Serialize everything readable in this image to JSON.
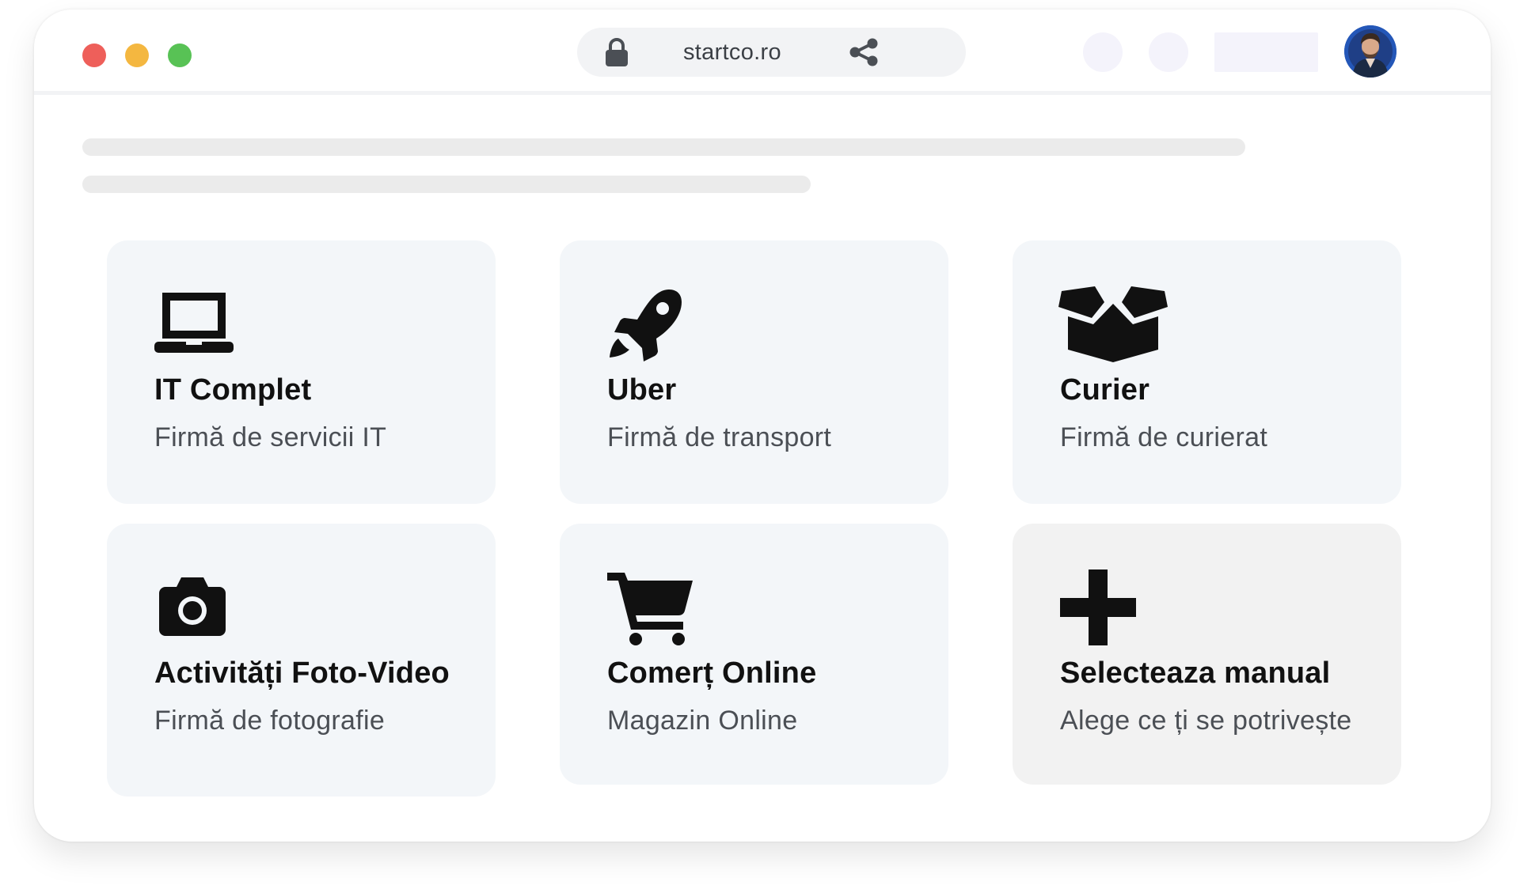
{
  "browser": {
    "url": "startco.ro",
    "window_controls": [
      "close",
      "minimize",
      "maximize"
    ],
    "icons": {
      "lock": "lock-icon",
      "share": "share-icon",
      "avatar": "user-avatar"
    }
  },
  "cards": [
    {
      "icon": "laptop-icon",
      "title": "IT Complet",
      "subtitle": "Firmă de servicii IT"
    },
    {
      "icon": "rocket-icon",
      "title": "Uber",
      "subtitle": "Firmă de transport"
    },
    {
      "icon": "box-open-icon",
      "title": "Curier",
      "subtitle": "Firmă de curierat"
    },
    {
      "icon": "camera-icon",
      "title": "Activități Foto-Video",
      "subtitle": "Firmă de fotografie"
    },
    {
      "icon": "shopping-cart-icon",
      "title": "Comerț Online",
      "subtitle": "Magazin Online"
    },
    {
      "icon": "plus-icon",
      "title": "Selecteaza manual",
      "subtitle": "Alege ce ți se potrivește"
    }
  ],
  "colors": {
    "card_background": "#f3f6f9",
    "manual_card_background": "#f2f2f2",
    "close_dot": "#ee5f5a",
    "minimize_dot": "#f4b740",
    "maximize_dot": "#58c255",
    "avatar_ring": "#2457b8"
  }
}
